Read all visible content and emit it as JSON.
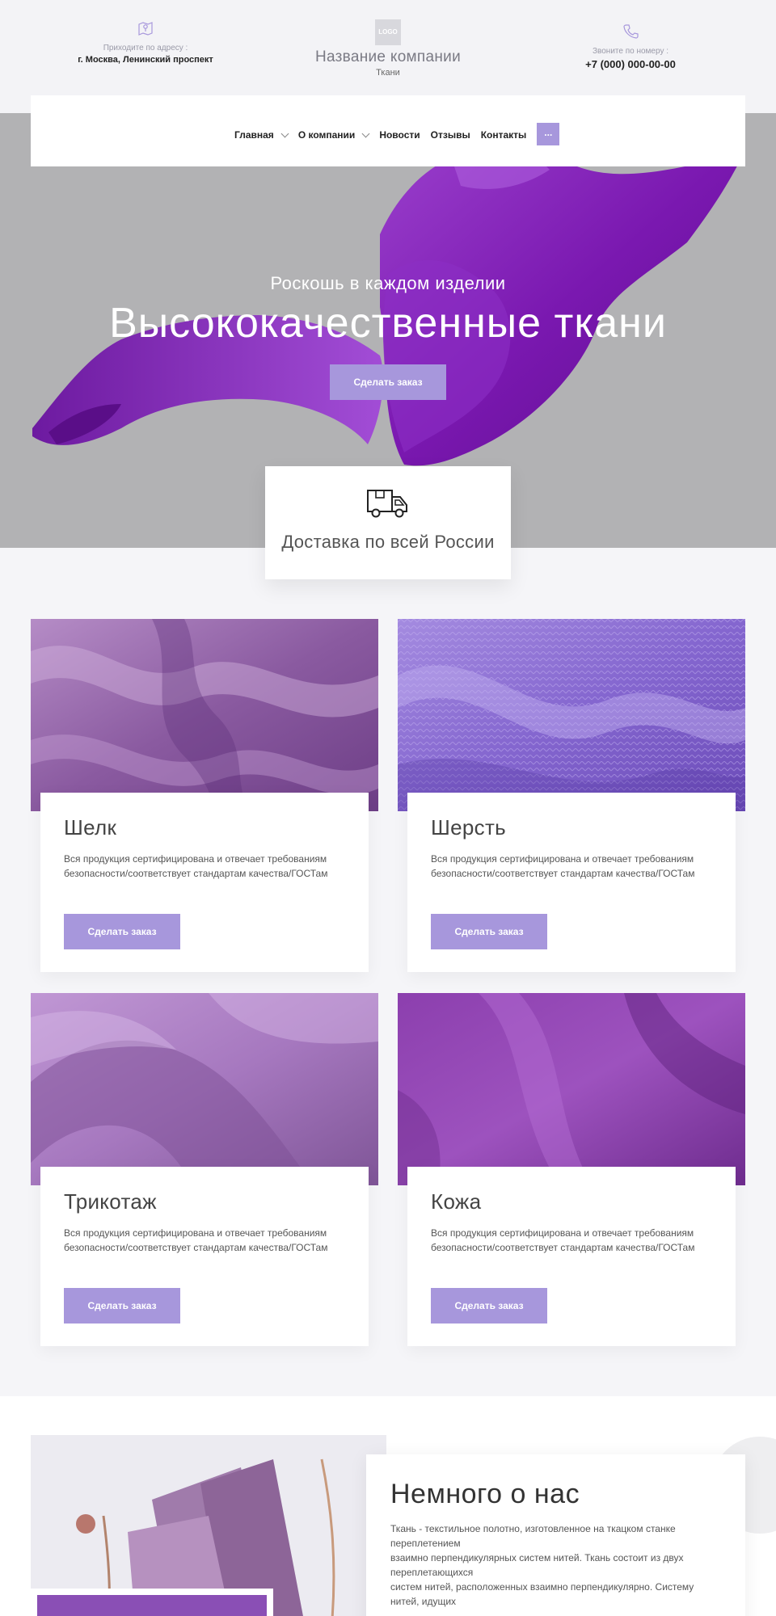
{
  "header": {
    "address_caption": "Приходите по адресу :",
    "address_value": "г. Москва, Ленинский проспект",
    "logo_text": "LOGO",
    "company_name": "Название компании",
    "company_sub": "Ткани",
    "phone_caption": "Звоните по номеру :",
    "phone_value": "+7 (000) 000-00-00"
  },
  "nav": {
    "items": [
      {
        "label": "Главная"
      },
      {
        "label": "О компании"
      },
      {
        "label": "Новости"
      },
      {
        "label": "Отзывы"
      },
      {
        "label": "Контакты"
      }
    ],
    "more_label": "..."
  },
  "hero": {
    "subtitle": "Роскошь в каждом изделии",
    "title": "Высококачественные ткани",
    "button": "Сделать заказ"
  },
  "delivery": {
    "text": "Доставка по всей России"
  },
  "products": [
    {
      "name": "Шелк",
      "desc": "Вся продукция сертифицирована и отвечает требованиям безопасности/соответствует стандартам качества/ГОСТам",
      "button": "Сделать заказ"
    },
    {
      "name": "Шерсть",
      "desc": "Вся продукция сертифицирована и отвечает требованиям безопасности/соответствует стандартам качества/ГОСТам",
      "button": "Сделать заказ"
    },
    {
      "name": "Трикотаж",
      "desc": "Вся продукция сертифицирована и отвечает требованиям безопасности/соответствует стандартам качества/ГОСТам",
      "button": "Сделать заказ"
    },
    {
      "name": "Кожа",
      "desc": "Вся продукция сертифицирована и отвечает требованиям безопасности/соответствует стандартам качества/ГОСТам",
      "button": "Сделать заказ"
    }
  ],
  "about": {
    "title": "Немного о нас",
    "lines": [
      "Ткань - текстильное полотно, изготовленное на ткацком станке переплетением",
      "взаимно перпендикулярных систем нитей. Ткань состоит из двух переплетающихся",
      "систем нитей, расположенных взаимно перпендикулярно. Систему нитей, идущих"
    ]
  },
  "colors": {
    "accent": "#a797dc",
    "hero_bg": "#b2b2b4",
    "silk_purple": "#7c1fb0"
  },
  "icons": {
    "address": "map-icon",
    "phone": "phone-icon",
    "delivery": "truck-icon"
  }
}
